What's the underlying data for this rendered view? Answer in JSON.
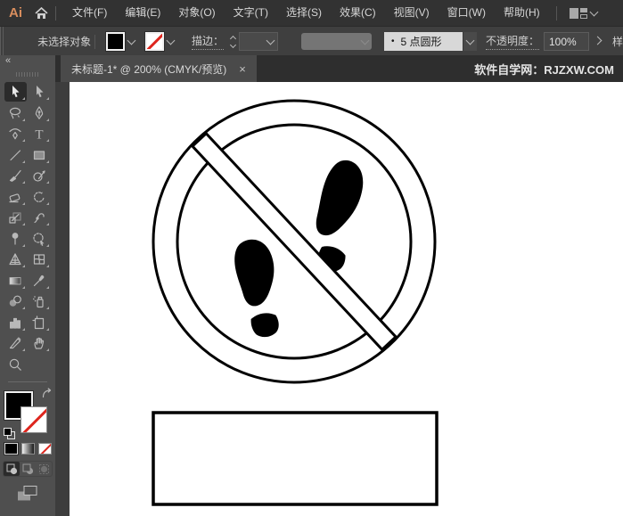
{
  "app": {
    "logo": "Ai",
    "watermark": "软件自学网：RJZXW.COM"
  },
  "menu": {
    "items": [
      "文件(F)",
      "编辑(E)",
      "对象(O)",
      "文字(T)",
      "选择(S)",
      "效果(C)",
      "视图(V)",
      "窗口(W)",
      "帮助(H)"
    ]
  },
  "control_bar": {
    "selection_status": "未选择对象",
    "fill_swatch_color": "#000000",
    "stroke_swatch": "none",
    "stroke_label": "描边：",
    "stroke_weight_value": "",
    "brush_bullet": "•",
    "brush_label": "5 点圆形",
    "opacity_label": "不透明度：",
    "opacity_value": "100%",
    "style_label_partial": "样"
  },
  "document_tab": {
    "title": "未标题-1* @ 200% (CMYK/预览)",
    "close_glyph": "×"
  },
  "toolbar": {
    "collapse_glyph": "«",
    "active_tool": "selection",
    "type_tool_glyph": "T",
    "tools": [
      "selection",
      "direct-selection",
      "lasso",
      "pen",
      "curvature",
      "type",
      "line-segment",
      "rectangle",
      "paintbrush",
      "shaper",
      "eraser",
      "rotate",
      "scale",
      "width",
      "puppet-warp",
      "shape-builder",
      "perspective-grid",
      "mesh",
      "gradient",
      "eyedropper",
      "blend",
      "symbol-sprayer",
      "column-graph",
      "artboard",
      "slice",
      "hand",
      "zoom"
    ],
    "fill_color": "#000000",
    "stroke_style": "none"
  },
  "colors": {
    "menu_bar": "#323232",
    "control_bar": "#3f3f3f",
    "panel": "#4f4f4f",
    "icon": "#b9b9b9",
    "red_slash": "#de261e",
    "canvas": "#ffffff",
    "artwork": "#000000"
  }
}
